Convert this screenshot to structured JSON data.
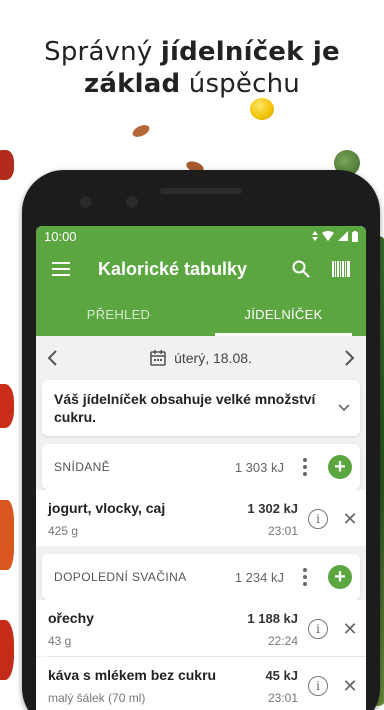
{
  "headline": {
    "line1_normal": "Správný ",
    "line1_bold": "jídelníček je",
    "line2_bold": "základ",
    "line2_normal": " úspěchu"
  },
  "status": {
    "time": "10:00"
  },
  "appbar": {
    "title": "Kalorické tabulky"
  },
  "tabs": [
    {
      "label": "PŘEHLED",
      "active": false
    },
    {
      "label": "JÍDELNÍČEK",
      "active": true
    }
  ],
  "date": {
    "label": "úterý, 18.08."
  },
  "warning": {
    "text": "Váš jídelníček obsahuje velké množství cukru."
  },
  "meals": [
    {
      "title": "SNÍDANĚ",
      "kj": "1 303 kJ",
      "items": [
        {
          "name": "jogurt, vlocky, caj",
          "qty": "425 g",
          "kj": "1 302 kJ",
          "time": "23:01"
        }
      ]
    },
    {
      "title": "DOPOLEDNÍ SVAČINA",
      "kj": "1 234 kJ",
      "items": [
        {
          "name": "ořechy",
          "qty": "43 g",
          "kj": "1 188 kJ",
          "time": "22:24"
        },
        {
          "name": "káva s mlékem bez cukru",
          "qty": "malý šálek (70 ml)",
          "kj": "45 kJ",
          "time": "23:01"
        }
      ]
    }
  ],
  "colors": {
    "accent": "#5ca641"
  },
  "icons": {
    "menu": "menu-icon",
    "search": "search-icon",
    "barcode": "barcode-icon",
    "calendar": "calendar-icon",
    "prev": "chevron-left-icon",
    "next": "chevron-right-icon",
    "expand": "chevron-down-icon",
    "more": "more-vertical-icon",
    "add": "plus-icon",
    "info": "info-icon",
    "remove": "close-icon"
  }
}
